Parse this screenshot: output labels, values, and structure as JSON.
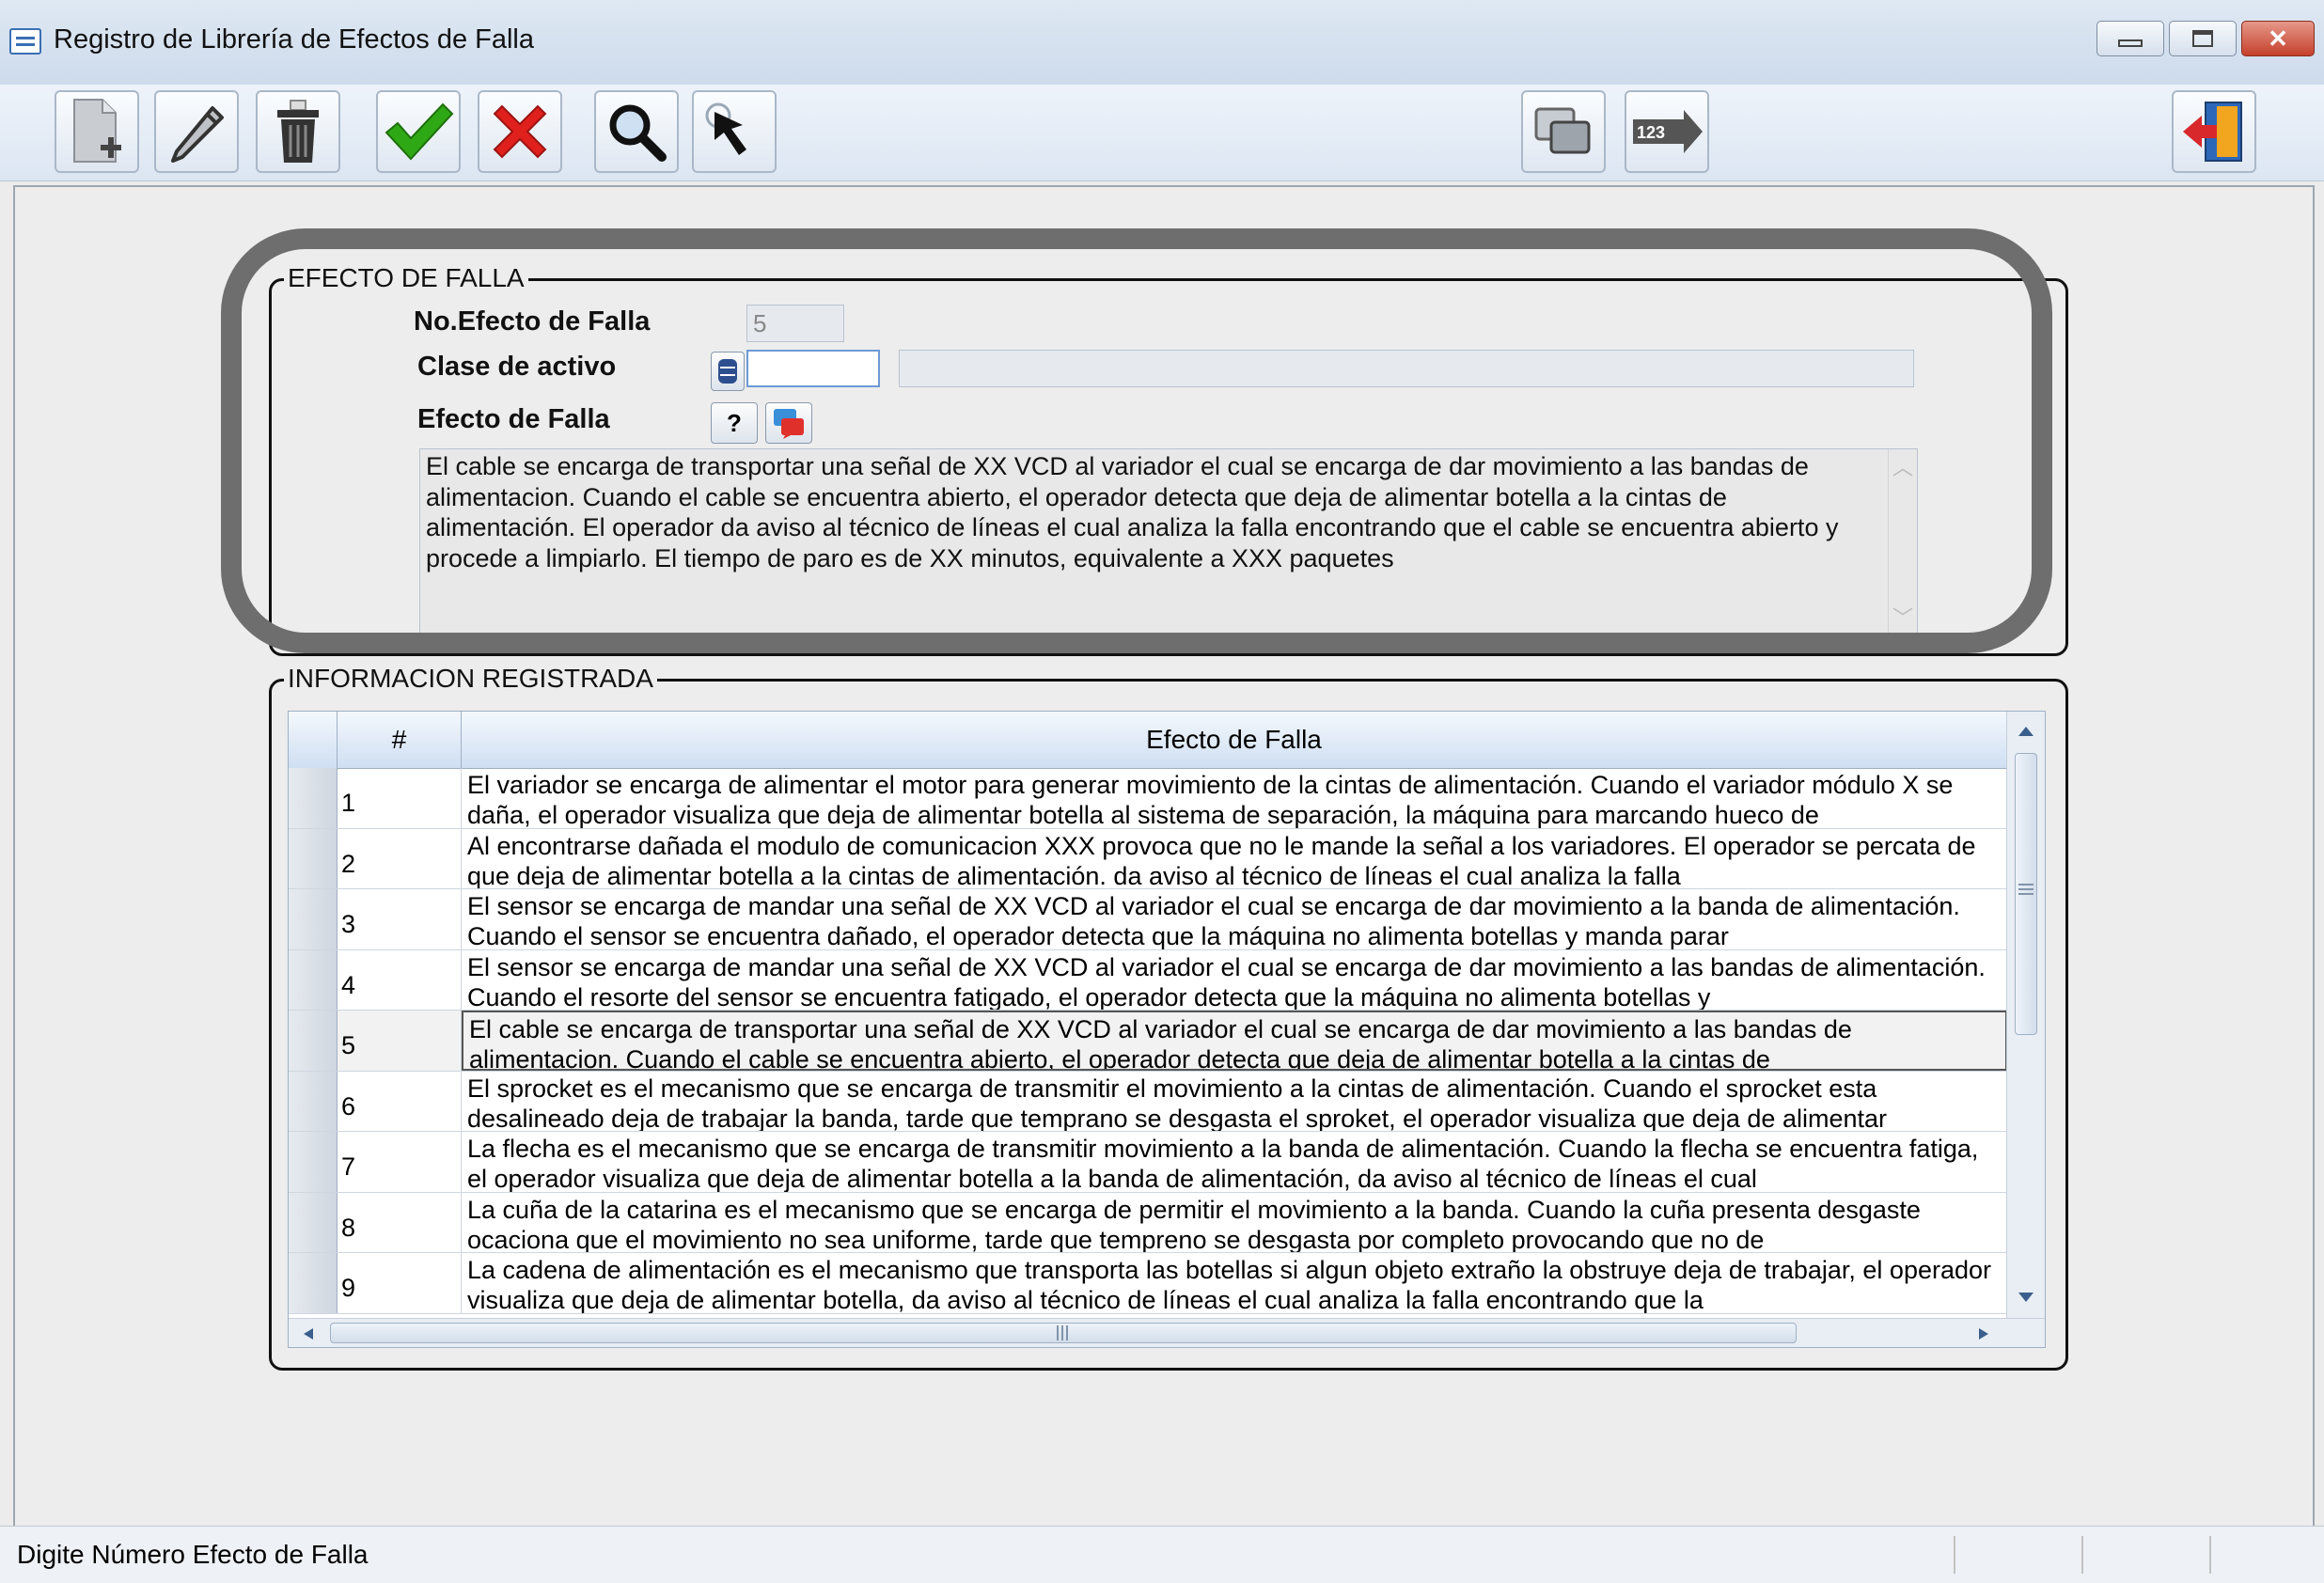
{
  "window": {
    "title": "Registro de Librería de Efectos de Falla",
    "minimize": "▭",
    "maximize": "▢",
    "close": "✕"
  },
  "toolbar": {
    "buttons": [
      {
        "name": "new-button",
        "icon": "new-document-icon"
      },
      {
        "name": "edit-button",
        "icon": "pencil-icon"
      },
      {
        "name": "delete-button",
        "icon": "trash-icon"
      },
      {
        "name": "accept-button",
        "icon": "checkmark-icon"
      },
      {
        "name": "cancel-button",
        "icon": "x-icon"
      },
      {
        "name": "search-button",
        "icon": "magnifier-icon"
      },
      {
        "name": "select-button",
        "icon": "cursor-arrow-icon"
      },
      {
        "name": "copy-button",
        "icon": "windows-icon"
      },
      {
        "name": "sequence-button",
        "icon": "numbered-arrow-icon"
      },
      {
        "name": "exit-button",
        "icon": "exit-door-icon"
      }
    ],
    "sequence_text": "123"
  },
  "efecto": {
    "legend": "EFECTO DE FALLA",
    "no_label": "No.Efecto de Falla",
    "no_value": "5",
    "clase_label": "Clase de activo",
    "clase_value": "",
    "clase_desc": "",
    "efecto_label": "Efecto de Falla",
    "help_button": "?",
    "description": "El cable se encarga de transportar una señal de XX VCD al variador el cual se encarga de dar movimiento a las bandas de alimentacion. Cuando el cable se encuentra abierto, el operador detecta que deja de alimentar botella a la cintas de alimentación. El operador da aviso al técnico de líneas el cual analiza la falla encontrando que el cable se encuentra abierto y procede a limpiarlo. El tiempo de paro es de XX minutos, equivalente a XXX paquetes"
  },
  "registrada": {
    "legend": "INFORMACION REGISTRADA",
    "columns": [
      "#",
      "Efecto de Falla"
    ],
    "rows": [
      {
        "num": "1",
        "text": "El variador se encarga de alimentar el motor para generar movimiento de la cintas de alimentación. Cuando el variador  módulo X se daña,  el operador visualiza que deja de alimentar botella al sistema de separación, la máquina para marcando hueco de"
      },
      {
        "num": "2",
        "text": "Al encontrarse dañada el modulo de comunicacion XXX   provoca que  no  le mande la señal a los variadores. El  operador se percata de que deja de alimentar botella a la cintas de alimentación.  da aviso al técnico de líneas el cual analiza la falla"
      },
      {
        "num": "3",
        "text": "El sensor se encarga de mandar una señal de XX VCD al variador el cual se encarga de dar movimiento a la banda de alimentación. Cuando el sensor se encuentra dañado, el operador detecta que  la máquina no alimenta botellas y manda parar"
      },
      {
        "num": "4",
        "text": "El sensor se encarga de mandar una señal de XX VCD al variador el cual se encarga de dar movimiento a las bandas de alimentación. Cuando el resorte del sensor se encuentra fatigado, el operador detecta que  la máquina no alimenta botellas y"
      },
      {
        "num": "5",
        "text": "El cable se encarga de transportar una señal de XX VCD al variador el cual se encarga de dar movimiento a las bandas de alimentacion. Cuando el cable se encuentra abierto, el operador detecta que deja de alimentar botella a la cintas de"
      },
      {
        "num": "6",
        "text": "El sprocket es el mecanismo que se encarga de transmitir el movimiento a la cintas de alimentación. Cuando el sprocket esta desalineado  deja de trabajar la banda, tarde que temprano se desgasta el sproket, el operador visualiza que deja de alimentar"
      },
      {
        "num": "7",
        "text": "La flecha es el mecanismo que se encarga de transmitir movimiento a la banda de alimentación. Cuando la flecha se encuentra fatiga, el operador visualiza que deja de alimentar botella a la banda de alimentación, da aviso al técnico de líneas el cual"
      },
      {
        "num": "8",
        "text": "La cuña de la catarina es el mecanismo que se encarga de permitir el movimiento a la banda. Cuando la cuña presenta desgaste ocaciona que el movimiento no sea uniforme, tarde que tempreno se desgasta por completo provocando que  no de"
      },
      {
        "num": "9",
        "text": "La cadena de alimentación es el mecanismo que  transporta  las botellas si  algun objeto extraño la obstruye  deja de trabajar, el operador visualiza que deja de alimentar botella,  da aviso al técnico de líneas el cual analiza la falla encontrando que la"
      }
    ],
    "selected_row": "5"
  },
  "status": {
    "message": "Digite Número Efecto de Falla"
  },
  "colors": {
    "accept": "#2fa815",
    "cancel": "#e0201c",
    "highlight_ring": "#6e6e6e",
    "exit": "#d8282c"
  }
}
